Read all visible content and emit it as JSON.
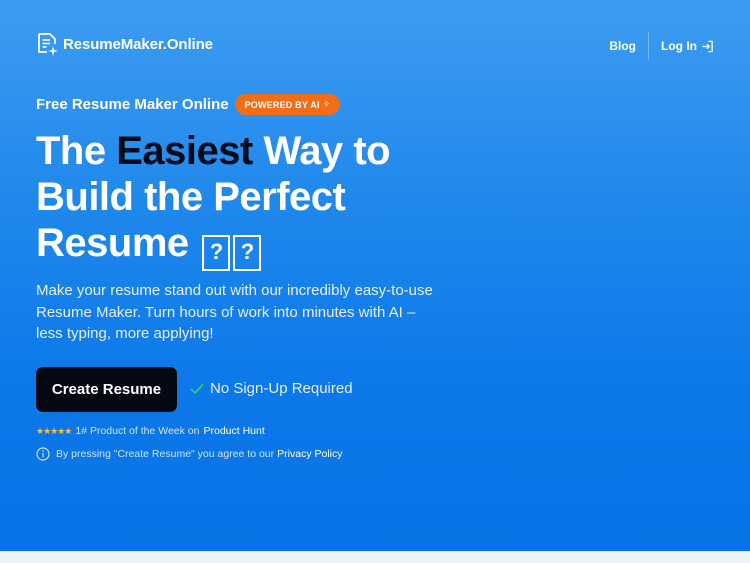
{
  "header": {
    "brand": "ResumeMaker.Online",
    "nav": {
      "blog": "Blog",
      "login": "Log In"
    }
  },
  "hero": {
    "eyebrow": "Free Resume Maker Online",
    "badge": "POWERED BY AI",
    "badge_symbol": "✧",
    "headline": {
      "part1": "The ",
      "highlight": "Easiest",
      "part2": " Way to Build the Perfect Resume",
      "emoji_placeholders": [
        "?",
        "?"
      ]
    },
    "subtext": "Make your resume stand out with our incredibly easy-to-use Resume Maker. Turn hours of work into minutes with AI – less typing, more applying!",
    "cta_label": "Create Resume",
    "no_signup": "No Sign-Up Required",
    "rating": {
      "stars": "★★★★★",
      "text": "1# Product of the Week on",
      "link": "Product Hunt"
    },
    "terms": {
      "text": "By pressing \"Create Resume\" you agree to our",
      "link": "Privacy Policy"
    }
  },
  "colors": {
    "hero_top": "#3d9cf0",
    "hero_bottom": "#0873e6",
    "badge": "#f26d16",
    "cta_bg": "#050914",
    "check": "#2bd46b",
    "stars": "#f6c042"
  },
  "icons": [
    "resume-doc-icon",
    "login-arrow-icon",
    "sparkle-icon",
    "check-icon",
    "info-icon"
  ]
}
